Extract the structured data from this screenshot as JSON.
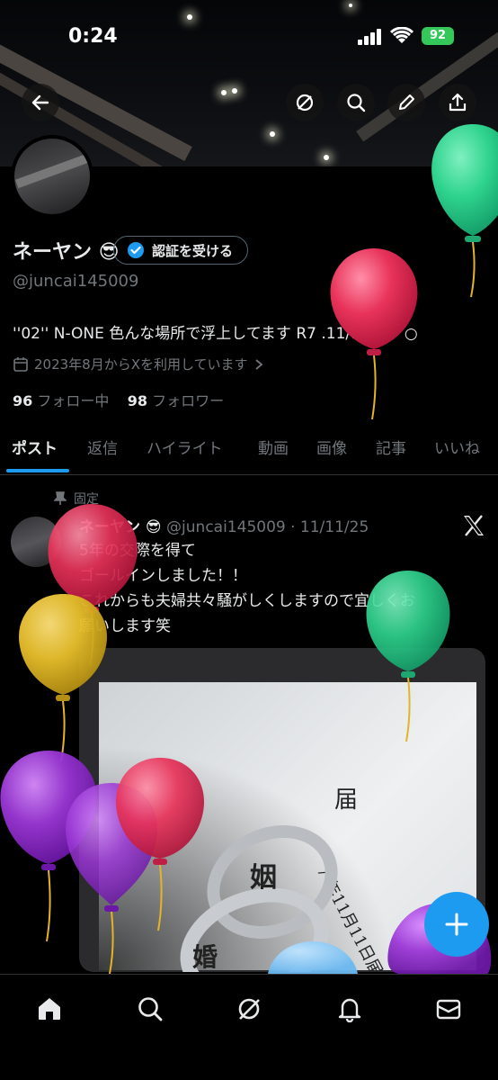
{
  "status_bar": {
    "time": "0:24",
    "battery": "92"
  },
  "profile": {
    "name": "ネーヤン 😎",
    "verify_label": "認証を受ける",
    "handle": "@juncai145009",
    "bio": "''02'' N-ONE 色んな場所で浮上してます R7 .11/11💍。○",
    "joined": "2023年8月からXを利用しています",
    "following_count": "96",
    "following_label": "フォロー中",
    "followers_count": "98",
    "followers_label": "フォロワー"
  },
  "tabs": [
    {
      "label": "ポスト",
      "active": true
    },
    {
      "label": "返信"
    },
    {
      "label": "ハイライト"
    },
    {
      "label": "動画"
    },
    {
      "label": "画像"
    },
    {
      "label": "記事"
    },
    {
      "label": "いいね"
    }
  ],
  "post": {
    "pinned_label": "固定",
    "author": "ネーヤン 😎",
    "meta": "@juncai145009 · 11/11/25",
    "lines": [
      "5年の交際を得て",
      "ゴールインしました！！",
      "これからも夫婦共々騒がしくしますので宜しくお",
      "願いします笑"
    ],
    "photo_kanji": [
      "届",
      "7 年11月11日届出",
      "婚",
      "姻"
    ]
  },
  "colors": {
    "accent": "#1d9bf0",
    "background": "#000000",
    "secondary_text": "#71767b",
    "balloon_green": "#2fd38e",
    "balloon_red": "#e8335a",
    "balloon_yellow": "#e9c02c",
    "balloon_purple": "#9b37d6"
  },
  "icons": {
    "back": "back-arrow-icon",
    "grok": "grok-icon",
    "search": "search-icon",
    "edit": "pencil-icon",
    "share": "share-icon",
    "pin": "pin-icon",
    "calendar": "calendar-icon",
    "x_logo": "x-logo-icon",
    "compose": "plus-icon",
    "home": "home-icon",
    "notifications": "bell-icon",
    "messages": "mail-icon"
  }
}
